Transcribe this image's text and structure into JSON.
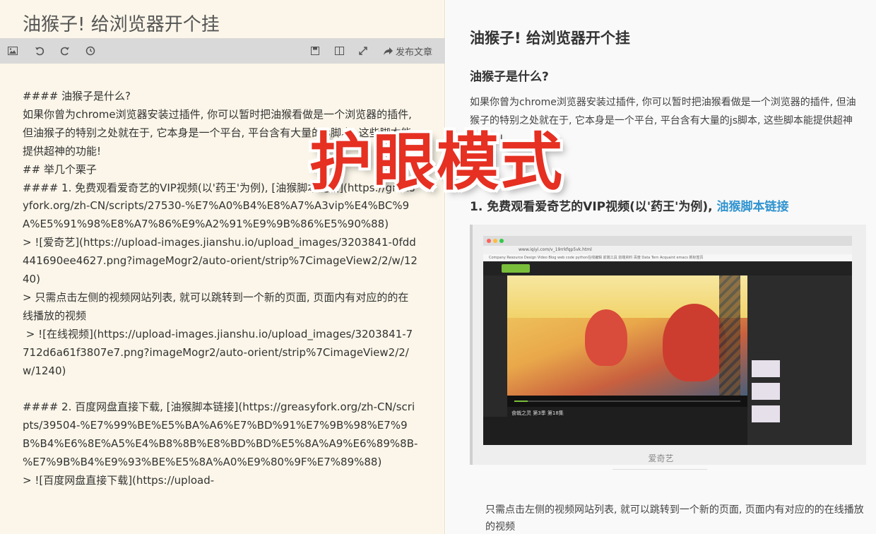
{
  "editor": {
    "title": "油猴子! 给浏览器开个挂",
    "toolbar": {
      "icons": [
        "image-icon",
        "undo-icon",
        "redo-icon",
        "history-icon",
        "save-icon",
        "split-view-icon",
        "fullscreen-icon",
        "share-icon"
      ],
      "publish_label": "发布文章"
    },
    "content": "#### 油猴子是什么?\n如果你曾为chrome浏览器安装过插件, 你可以暂时把油猴看做是一个浏览器的插件, 但油猴子的特别之处就在于, 它本身是一个平台, 平台含有大量的js脚本, 这些脚本能提供超神的功能!\n## 举几个栗子\n#### 1. 免费观看爱奇艺的VIP视频(以'药王'为例), [油猴脚本链接](https://greasyfork.org/zh-CN/scripts/27530-%E7%A0%B4%E8%A7%A3vip%E4%BC%9A%E5%91%98%E8%A7%86%E9%A2%91%E9%9B%86%E5%90%88)\n> ![爱奇艺](https://upload-images.jianshu.io/upload_images/3203841-0fdd441690ee4627.png?imageMogr2/auto-orient/strip%7CimageView2/2/w/1240)\n> 只需点击左侧的视频网站列表, 就可以跳转到一个新的页面, 页面内有对应的的在线播放的视频\n > ![在线视频](https://upload-images.jianshu.io/upload_images/3203841-7712d6a61f3807e7.png?imageMogr2/auto-orient/strip%7CimageView2/2/w/1240)\n\n#### 2. 百度网盘直接下载, [油猴脚本链接](https://greasyfork.org/zh-CN/scripts/39504-%E7%99%BE%E5%BA%A6%E7%BD%91%E7%9B%98%E7%9B%B4%E6%8E%A5%E4%B8%8B%E8%BD%BD%E5%8A%A9%E6%89%8B-%E7%9B%B4%E9%93%BE%E5%8A%A0%E9%80%9F%E7%89%88)\n> ![百度网盘直接下载](https://upload-"
  },
  "preview": {
    "title": "油猴子! 给浏览器开个挂",
    "h4_what": "油猴子是什么?",
    "para1": "如果你曾为chrome浏览器安装过插件, 你可以暂时把油猴看做是一个浏览器的插件, 但油猴子的特别之处就在于, 它本身是一个平台, 平台含有大量的js脚本, 这些脚本能提供超神的功能!",
    "h4_example_text": "1. 免费观看爱奇艺的VIP视频(以'药王'为例), ",
    "h4_example_link": "油猴脚本链接",
    "screenshot": {
      "url": "www.iqiyi.com/v_19rrkfqp5vk.html",
      "bookmarks": "Company  Resource  Design  Video  Blog  web  code  python在线编辑  前端工具  前端资料  百度  Data  Tern  Acquaint  emacs  新标签页",
      "episode_title": "食戟之灵 第3季 第18集",
      "progress": 0.06
    },
    "caption": "爱奇艺",
    "para2": "只需点击左侧的视频网站列表, 就可以跳转到一个新的页面, 页面内有对应的的在线播放的视频"
  },
  "overlay_label": "护眼模式"
}
